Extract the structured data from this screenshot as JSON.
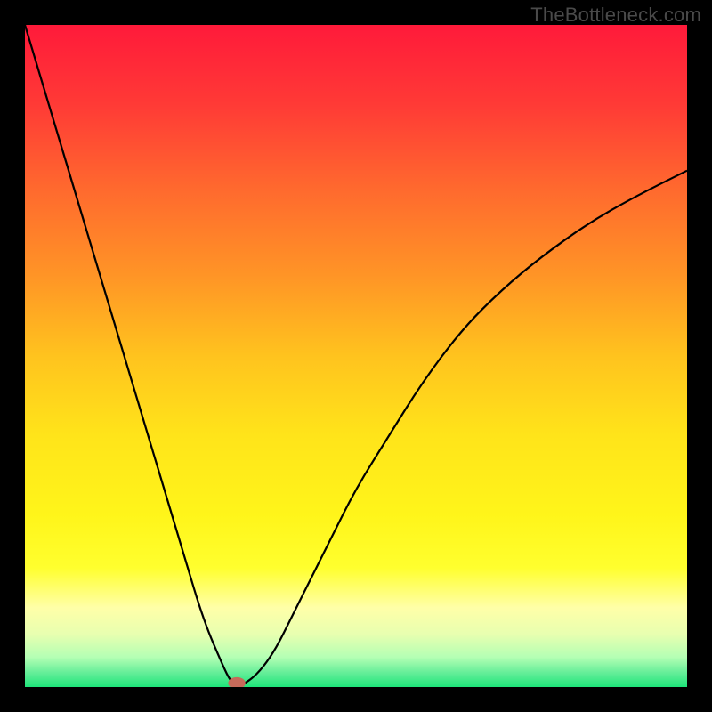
{
  "watermark": "TheBottleneck.com",
  "chart_data": {
    "type": "line",
    "title": "",
    "xlabel": "",
    "ylabel": "",
    "xlim": [
      0,
      100
    ],
    "ylim": [
      0,
      100
    ],
    "annotations": [],
    "background_gradient_stops": [
      {
        "offset": 0.0,
        "color": "#ff1a3a"
      },
      {
        "offset": 0.12,
        "color": "#ff3a36"
      },
      {
        "offset": 0.25,
        "color": "#ff6a2e"
      },
      {
        "offset": 0.38,
        "color": "#ff9526"
      },
      {
        "offset": 0.5,
        "color": "#ffc31e"
      },
      {
        "offset": 0.62,
        "color": "#ffe41a"
      },
      {
        "offset": 0.74,
        "color": "#fff51a"
      },
      {
        "offset": 0.82,
        "color": "#ffff2e"
      },
      {
        "offset": 0.88,
        "color": "#ffffa8"
      },
      {
        "offset": 0.92,
        "color": "#e8ffb0"
      },
      {
        "offset": 0.955,
        "color": "#b4ffb4"
      },
      {
        "offset": 0.978,
        "color": "#66ee99"
      },
      {
        "offset": 1.0,
        "color": "#1ee57a"
      }
    ],
    "series": [
      {
        "name": "bottleneck-curve",
        "stroke": "#000000",
        "x": [
          0,
          3,
          6,
          9,
          12,
          15,
          18,
          21,
          24,
          27,
          30,
          31,
          32,
          34,
          36,
          38,
          40,
          43,
          46,
          50,
          55,
          60,
          66,
          72,
          78,
          85,
          92,
          100
        ],
        "values": [
          100,
          90,
          80,
          70,
          60,
          50,
          40,
          30,
          20,
          10,
          3,
          1,
          0,
          1,
          3,
          6,
          10,
          16,
          22,
          30,
          38,
          46,
          54,
          60,
          65,
          70,
          74,
          78
        ]
      }
    ],
    "marker": {
      "name": "bottleneck-point",
      "x": 32,
      "y": 0.6,
      "rx_pct": 1.3,
      "ry_pct": 0.9,
      "color": "#c66a5a"
    }
  }
}
